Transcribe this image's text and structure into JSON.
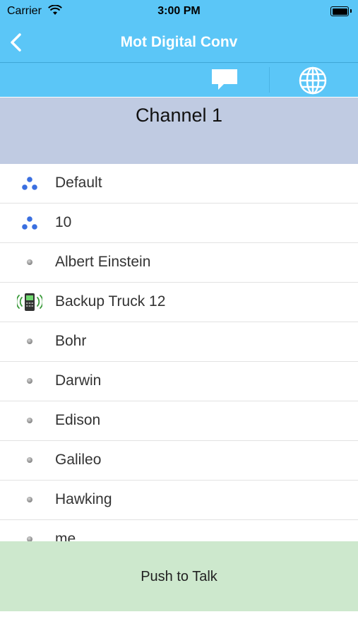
{
  "status_bar": {
    "carrier": "Carrier",
    "time": "3:00 PM"
  },
  "nav": {
    "title": "Mot Digital Conv"
  },
  "toolbar": {
    "items": [
      "message-icon",
      "globe-icon"
    ]
  },
  "channel": {
    "name": "Channel 1"
  },
  "list": {
    "items": [
      {
        "label": "Default",
        "icon": "group-icon"
      },
      {
        "label": "10",
        "icon": "group-icon"
      },
      {
        "label": "Albert Einstein",
        "icon": "user-dot-icon"
      },
      {
        "label": "Backup Truck 12",
        "icon": "radio-device-icon"
      },
      {
        "label": "Bohr",
        "icon": "user-dot-icon"
      },
      {
        "label": "Darwin",
        "icon": "user-dot-icon"
      },
      {
        "label": "Edison",
        "icon": "user-dot-icon"
      },
      {
        "label": "Galileo",
        "icon": "user-dot-icon"
      },
      {
        "label": "Hawking",
        "icon": "user-dot-icon"
      },
      {
        "label": "me",
        "icon": "user-dot-icon"
      }
    ]
  },
  "ptt": {
    "label": "Push to Talk"
  },
  "colors": {
    "bar": "#5bc6f7",
    "channel_bg": "#c0cbe2",
    "ptt_bg": "#cde8cd",
    "group_dot": "#3a6fe0"
  }
}
